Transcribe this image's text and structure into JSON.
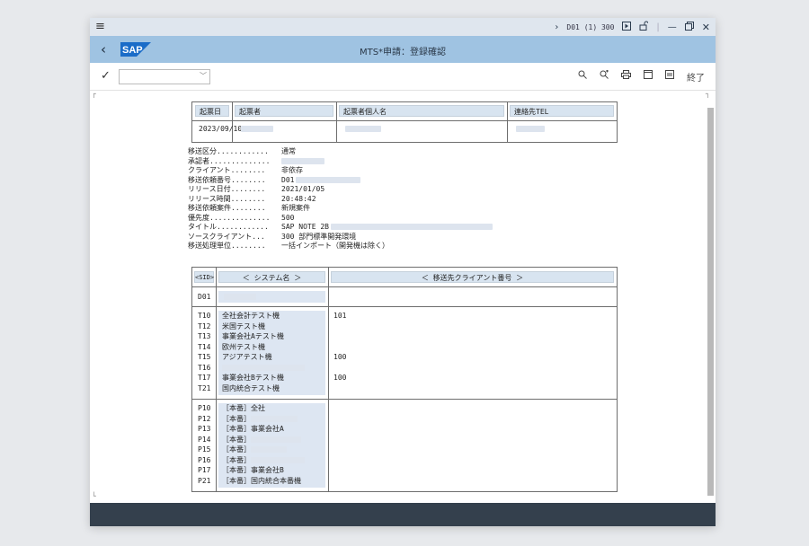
{
  "window": {
    "system_info": "D01 (1) 300",
    "title": "MTS*申請：登録確認",
    "logo_text": "SAP",
    "exit_label": "終了"
  },
  "table1": {
    "headers": [
      "起票日",
      "起票者",
      "起票者個人名",
      "連絡先TEL"
    ],
    "row": {
      "date": "2023/09/10"
    }
  },
  "info": [
    {
      "label": "移送区分............",
      "value": "通常"
    },
    {
      "label": "承認者..............",
      "value": ""
    },
    {
      "label": "クライアント........",
      "value": "非依存"
    },
    {
      "label": "移送依頼番号........",
      "value": "D01"
    },
    {
      "label": "リリース日付........",
      "value": "2021/01/05"
    },
    {
      "label": "リリース時間........",
      "value": "20:48:42"
    },
    {
      "label": "移送依頼案件........",
      "value": "新規案件"
    },
    {
      "label": "優先度..............",
      "value": "500"
    },
    {
      "label": "タイトル............",
      "value": "SAP NOTE 2B"
    },
    {
      "label": "ソースクライアント...",
      "value": "300 部門標準開発環境"
    },
    {
      "label": "移送処理単位........",
      "value": "一括インポート（開発機は除く）"
    }
  ],
  "table2": {
    "headers": {
      "sid": "<SID>",
      "system": "＜ システム名 ＞",
      "client": "＜ 移送先クライアント番号 ＞"
    },
    "dev_sid": "D01",
    "test": {
      "sids": [
        "T10",
        "T12",
        "T13",
        "T14",
        "T15",
        "T16",
        "T17",
        "T21"
      ],
      "names": [
        "全社会計テスト機",
        "米国テスト機",
        "事業会社Aテスト機",
        "欧州テスト機",
        "アジアテスト機",
        "",
        "事業会社Bテスト機",
        "国内統合テスト機"
      ],
      "clients": [
        "101",
        "",
        "",
        "",
        "100",
        "",
        "100",
        ""
      ]
    },
    "prod": {
      "sids": [
        "P10",
        "P12",
        "P13",
        "P14",
        "P15",
        "P16",
        "P17",
        "P21"
      ],
      "names": [
        "［本番］全社",
        "［本番］",
        "［本番］事業会社A",
        "［本番］",
        "［本番］",
        "［本番］",
        "［本番］事業会社B",
        "［本番］国内統合本番機"
      ]
    }
  },
  "colors": {
    "header": "#9fc3e2",
    "topbar": "#dfe6ee",
    "footer": "#34404d"
  },
  "icons": [
    "menu-icon",
    "chevron-right-icon",
    "play-icon",
    "unlock-icon",
    "minimize-icon",
    "restore-icon",
    "close-icon",
    "back-icon",
    "check-icon",
    "search-icon",
    "search-next-icon",
    "print-icon",
    "window-icon",
    "layout-icon"
  ]
}
